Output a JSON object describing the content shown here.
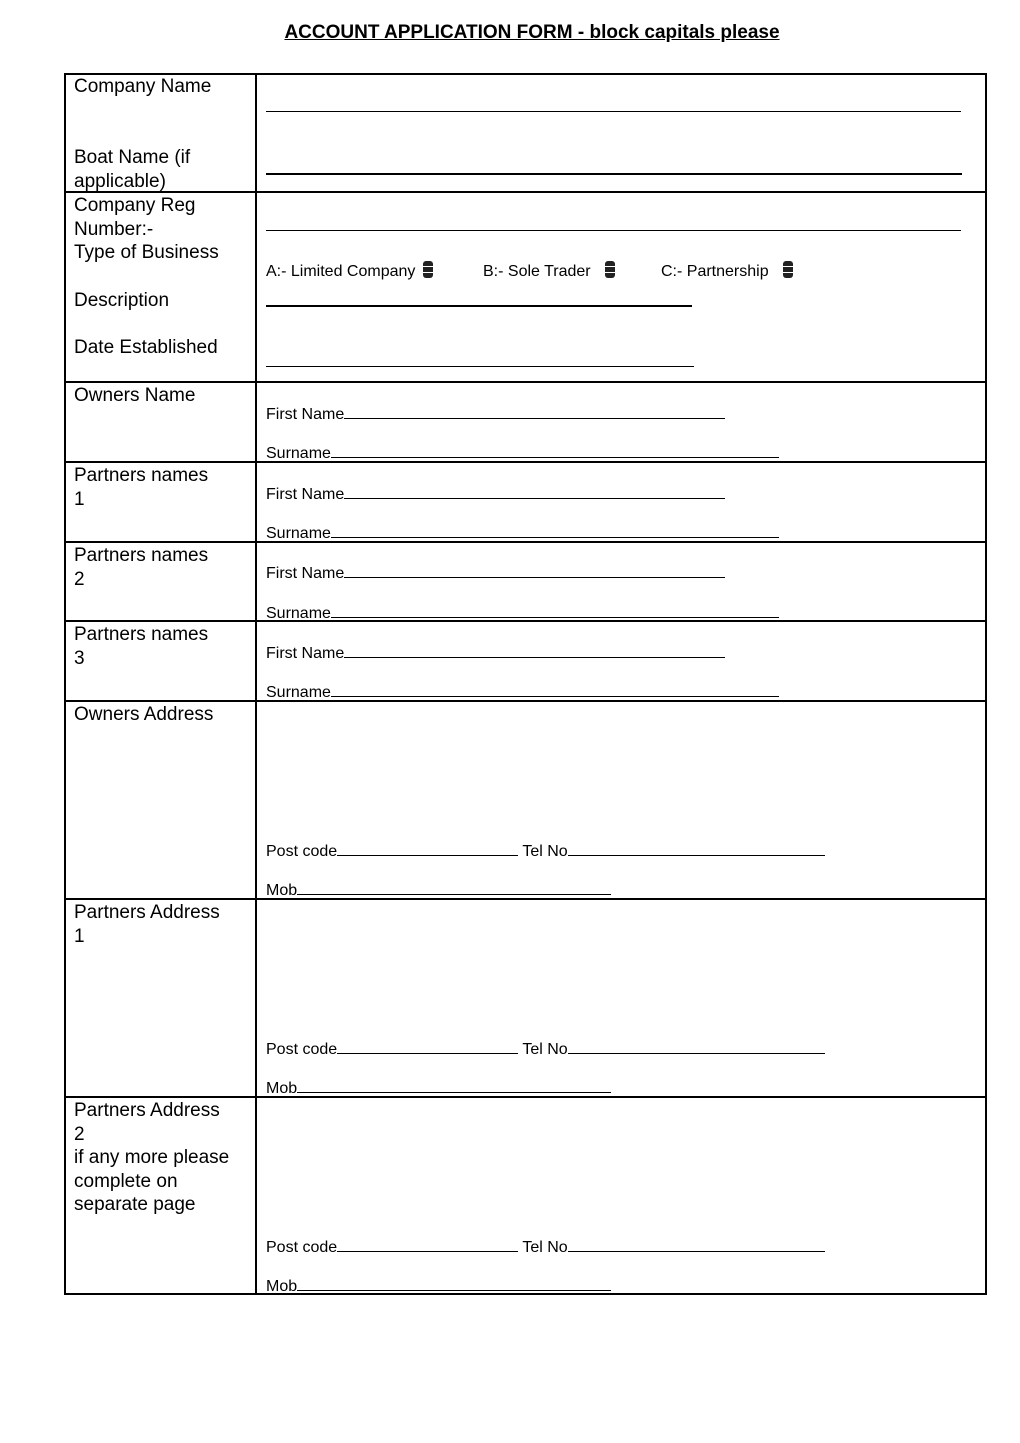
{
  "title": "ACCOUNT APPLICATION FORM - block capitals please",
  "labels": {
    "company_name": "Company Name",
    "boat_name": "Boat Name (if\napplicable)",
    "company_reg": "Company Reg\nNumber:-",
    "type_of_business": "Type of Business",
    "description": "Description",
    "date_established": "Date Established",
    "owners_name": "Owners Name",
    "partners_names_1": "Partners names\n1",
    "partners_names_2": "Partners names\n2",
    "partners_names_3": "Partners names\n3",
    "owners_address": "Owners Address",
    "partners_address_1": "Partners Address\n1",
    "partners_address_2": "Partners Address\n2\nif any more please\ncomplete on\nseparate page"
  },
  "business_types": [
    "A:- Limited Company",
    "B:- Sole Trader",
    "C:- Partnership"
  ],
  "fields": {
    "first_name": "First Name",
    "surname": "Surname",
    "post_code": "Post code",
    "tel_no": "Tel No",
    "mob": "Mob"
  }
}
